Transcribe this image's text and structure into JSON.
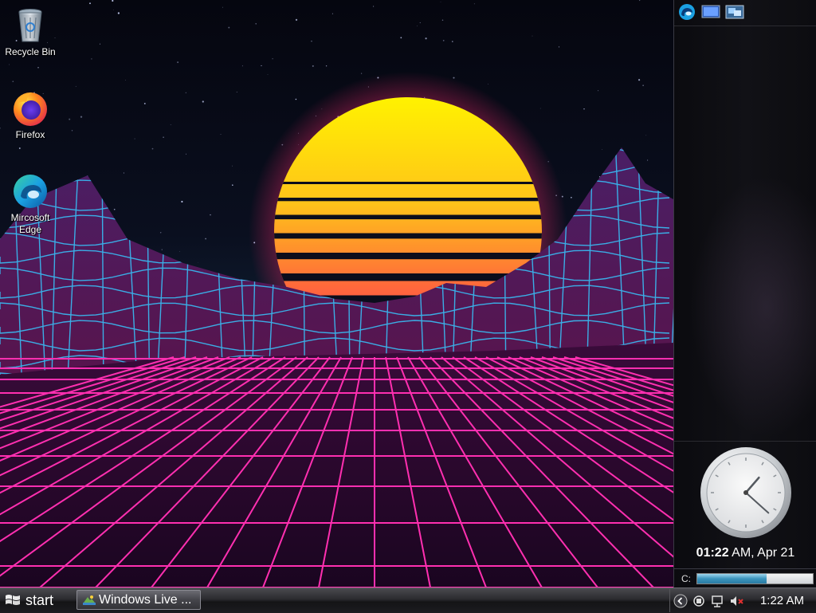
{
  "desktop": {
    "icons": [
      {
        "label": "Recycle Bin",
        "icon": "recycle-bin-icon"
      },
      {
        "label": "Firefox",
        "icon": "firefox-icon"
      },
      {
        "label": "Mircosoft\nEdge",
        "icon": "edge-icon"
      }
    ]
  },
  "sidebar": {
    "toolbar_icons": [
      "edge-icon",
      "monitor-icon",
      "network-icon"
    ],
    "clock": {
      "time_bold": "01:22",
      "time_rest": " AM, Apr 21"
    },
    "drive": {
      "label": "C:",
      "used_fraction": 0.6
    }
  },
  "taskbar": {
    "start_label": "start",
    "task_label": "Windows Live ...",
    "tray_icons": [
      "chevron-left-icon",
      "network-icon",
      "safely-remove-icon",
      "speaker-muted-icon"
    ],
    "time": "1:22 AM"
  },
  "colors": {
    "grid_pink": "#ff2fb0",
    "grid_cyan": "#37c8ff",
    "sun_top": "#ffee00",
    "sun_bottom": "#ff2e63"
  }
}
